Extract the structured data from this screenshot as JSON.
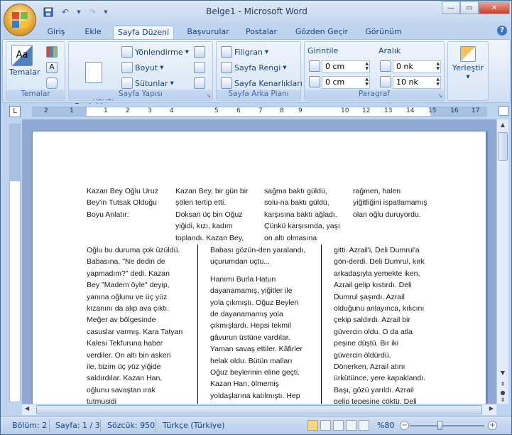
{
  "window": {
    "title": "Belge1 - Microsoft Word"
  },
  "tabs": [
    "Giriş",
    "Ekle",
    "Sayfa Düzeni",
    "Başvurular",
    "Postalar",
    "Gözden Geçir",
    "Görünüm"
  ],
  "active_tab": "Sayfa Düzeni",
  "ribbon": {
    "temalar": {
      "button": "Temalar",
      "label": "Temalar"
    },
    "sayfa_yapisi": {
      "kenar": "Kenar\nBoşlukları",
      "yonlendirme": "Yönlendirme",
      "boyut": "Boyut",
      "sutunlar": "Sütunlar",
      "label": "Sayfa Yapısı"
    },
    "sayfa_arka_plani": {
      "filigran": "Filigran",
      "sayfa_rengi": "Sayfa Rengi",
      "kenarliklar": "Sayfa Kenarlıkları",
      "label": "Sayfa Arka Planı"
    },
    "paragraf": {
      "girintile": "Girintile",
      "aralik": "Aralık",
      "indent_left": "0 cm",
      "indent_right": "0 cm",
      "space_before": "0 nk",
      "space_after": "10 nk",
      "label": "Paragraf"
    },
    "yerlestir": {
      "button": "Yerleştir"
    }
  },
  "ruler": {
    "ticks": [
      "2",
      "1",
      "1",
      "2",
      "3",
      "4",
      "5",
      "6",
      "7",
      "8",
      "9",
      "10",
      "12",
      "13",
      "14",
      "15",
      "16",
      "17",
      "18"
    ]
  },
  "document": {
    "top_cols": [
      [
        "Kazan Bey Oğlu Uruz",
        "Bey'in Tutsak Olduğu",
        "Boyu Anlatır:"
      ],
      [
        "Kazan Bey, bir gün bir",
        "şölen tertip etti.",
        "Doksan üç bin Oğuz",
        "yiğidi, kızı, kadım",
        "toplandı. Kazan Bey,"
      ],
      [
        "sağma baktı güldü,",
        "solu-na baktı güldü,",
        "karşısına baktı ağladı.",
        "Çünkü karşısında, yaşı",
        "on altı olmasına"
      ],
      [
        "rağmen, halen",
        "yiğitliğini ispatlamamış",
        "olan oğlu duruyordu."
      ]
    ],
    "col1": [
      "Oğlu bu duruma çok üzüldü.",
      "Babasına, \"Ne dedin de",
      "yapmadım?\" dedi. Kazan",
      "Bey \"Madem öyle\" deyip,",
      "yanına oğlunu ve üç yüz",
      "kızanını da alıp ava çıktı.",
      "Meğer av bölgesinde",
      "casuslar varmış. Kara Tatyan",
      "Kalesi Tekfuruna haber",
      "verdiler. On altı bin askeri",
      "ile, bizim üç yüz yiğide",
      "saldırdılar. Kazan Han,",
      "oğlunu savaştan ırak",
      "tutmuşidi"
    ],
    "col2a": [
      "Babası gözün-den yaralandı,",
      "uçurumdan uçtu..."
    ],
    "col2b": [
      "Hanımı Burla Hatun",
      "dayanamamış, yiğitler ile",
      "yola çıkmıştı. Oğuz Beyleri",
      "de dayanamamış yola",
      "çıkmışlardı. Hepsi tekmil",
      "gâvurun üstüne vardılar.",
      "Yaman savaş ettiler. Kâfirler",
      "helak oldu. Bütün malları",
      "Oğuz beylerinin eline geçti.",
      "Kazan Han, ölmemiş",
      "yoldaşlarına katılmıştı. Hep"
    ],
    "col3": [
      "gitti. Azrail'i, Deli Dumrul'a",
      "gön-derdi. Deli Dumrul, kırk",
      "arkadaşıyla yemekte iken,",
      "Azrail gelip kıstırdı. Deli",
      "Dumrul şaşırdı. Azrail",
      "olduğunu anlayınca, kılıcını",
      "çekip saldırdı. Azrail bir",
      "güvercin oldu. O da atla",
      "peşine düştü. Bir iki",
      "güvercin öldürdü.",
      "Dönerken, Azrail atını",
      "ürkütünce, yere kapaklandı.",
      "Başı, gözü yarıldı. Azrail",
      "gelip tepesine çöktü. Deli"
    ]
  },
  "status": {
    "bolum": "Bölüm: 2",
    "sayfa": "Sayfa: 1 / 3",
    "sozcuk": "Sözcük: 950",
    "dil": "Türkçe (Türkiye)",
    "zoom": "%80",
    "zoom_level": 0.4
  }
}
